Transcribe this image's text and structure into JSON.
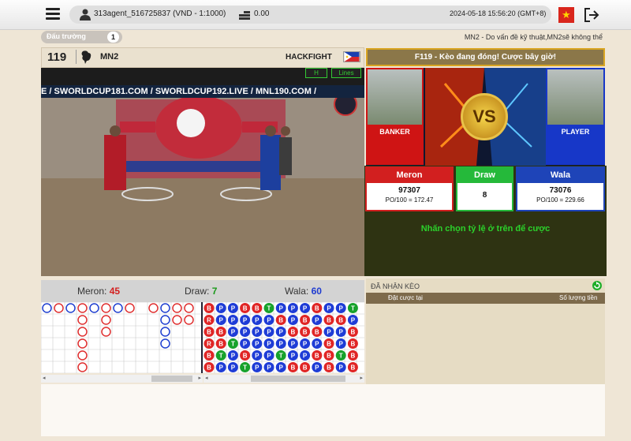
{
  "topbar": {
    "menu_icon": "hamburger-icon",
    "user_icon": "user-icon",
    "username": "313agent_516725837 (VND - 1:1000)",
    "coin_icon": "coins-icon",
    "balance": "0.00",
    "datetime": "2024-05-18   15:56:20 (GMT+8)",
    "language_flag": "vietnam-flag-icon",
    "logout_icon": "logout-icon"
  },
  "arena": {
    "label": "Đấu trường",
    "count": "1"
  },
  "notice": "MN2 - Do vấn đề kỹ thuật,MN2sẽ không thể",
  "fight": {
    "number": "119",
    "channel": "MN2",
    "event": "HACKFIGHT",
    "video_ribbon": "E / SWORLDCUP181.COM / SWORLDCUP192.LIVE / MNL190.COM /",
    "btn_h": "H",
    "btn_lines": "Lines"
  },
  "banner": "F119 - Kèo đang đóng! Cược bây giờ!",
  "fightcard": {
    "banker": "BANKER",
    "player": "PLAYER",
    "vs": "VS"
  },
  "odds": {
    "meron": {
      "label": "Meron",
      "value": "97307",
      "po": "PO/100 = 172.47"
    },
    "draw": {
      "label": "Draw",
      "value": "8"
    },
    "wala": {
      "label": "Wala",
      "value": "73076",
      "po": "PO/100 = 229.66"
    }
  },
  "hint": "Nhấn chọn tỷ lệ ở trên để cược",
  "stats": {
    "meron_label": "Meron:",
    "meron_value": "45",
    "draw_label": "Draw:",
    "draw_value": "7",
    "wala_label": "Wala:",
    "wala_value": "60"
  },
  "bead_road": {
    "columns": [
      [
        "B",
        "R",
        "B",
        "R",
        "B",
        "B"
      ],
      [
        "P",
        "P",
        "B",
        "B",
        "T",
        "P"
      ],
      [
        "P",
        "P",
        "P",
        "T",
        "P",
        "P"
      ],
      [
        "B",
        "P",
        "P",
        "P",
        "B",
        "T"
      ],
      [
        "B",
        "P",
        "P",
        "P",
        "P",
        "P"
      ],
      [
        "T",
        "P",
        "P",
        "P",
        "P",
        "P"
      ],
      [
        "P",
        "B",
        "P",
        "P",
        "T",
        "P"
      ],
      [
        "P",
        "P",
        "B",
        "P",
        "P",
        "B"
      ],
      [
        "P",
        "B",
        "B",
        "P",
        "P",
        "B"
      ],
      [
        "B",
        "P",
        "B",
        "P",
        "B",
        "P"
      ],
      [
        "P",
        "B",
        "P",
        "B",
        "B",
        "B"
      ],
      [
        "P",
        "B",
        "P",
        "P",
        "T",
        "P"
      ],
      [
        "T",
        "P",
        "B",
        "B",
        "B",
        "B"
      ]
    ]
  },
  "bet_panel": {
    "title": "ĐÃ NHẬN KÈO",
    "col_place": "Đặt cược tại",
    "col_amount": "Số lượng tiền",
    "refresh_icon": "refresh-icon"
  }
}
